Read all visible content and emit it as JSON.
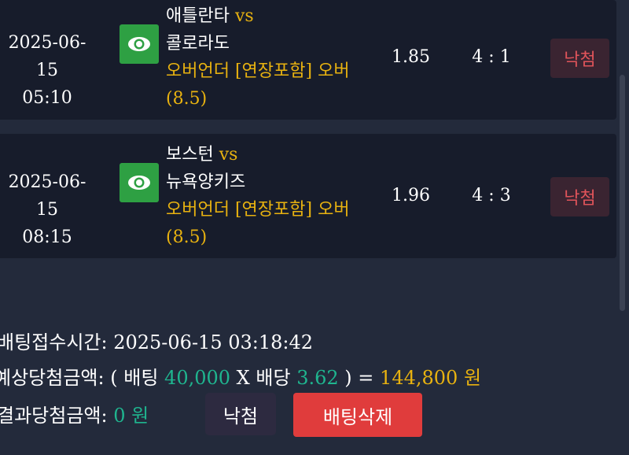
{
  "bets": [
    {
      "date": "2025-06-15",
      "time": "05:10",
      "home_team": "애틀란타",
      "vs": "vs",
      "away_team": "콜로라도",
      "pick": "오버언더 [연장포함] 오버",
      "line": "(8.5)",
      "odds": "1.85",
      "score": "4 : 1",
      "status": "낙첨",
      "icon": "eye-icon"
    },
    {
      "date": "2025-06-15",
      "time": "08:15",
      "home_team": "보스턴",
      "vs": "vs",
      "away_team": "뉴욕양키즈",
      "pick": "오버언더 [연장포함] 오버",
      "line": "(8.5)",
      "odds": "1.96",
      "score": "4 : 3",
      "status": "낙첨",
      "icon": "eye-icon"
    }
  ],
  "summary": {
    "bet_time_label": "배팅접수시간:",
    "bet_time_value": "2025-06-15 03:18:42",
    "expected_label": "예상당첨금액:",
    "open_paren": "(",
    "bet_label": "배팅",
    "bet_amount": "40,000",
    "times": "X",
    "odds_label": "배당",
    "total_odds": "3.62",
    "close_eq": ") =",
    "expected_amount": "144,800",
    "won": "원",
    "result_label": "결과당첨금액:",
    "result_amount": "0 원",
    "result_button": "낙첨",
    "delete_button": "배팅삭제"
  },
  "colors": {
    "background": "#232a3b",
    "card": "#171c2b",
    "accent_gold": "#e8b210",
    "accent_green": "#1fb58f",
    "delete_red": "#e03c3c",
    "lose_text": "#e0545a"
  }
}
